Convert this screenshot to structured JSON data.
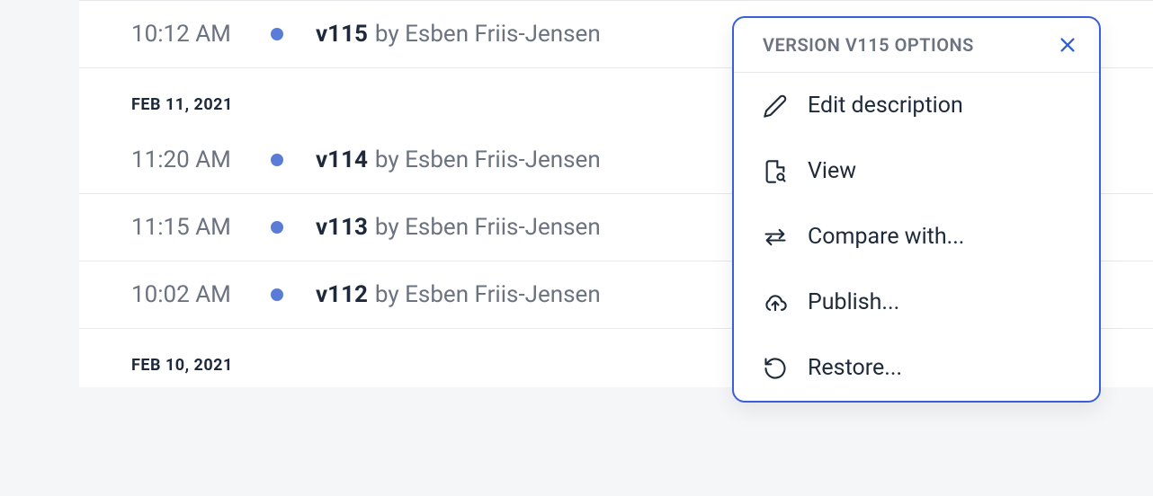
{
  "groups": [
    {
      "date": null,
      "rows": [
        {
          "time": "10:12 AM",
          "version": "v115",
          "by": "by Esben Friis-Jensen"
        }
      ]
    },
    {
      "date": "FEB 11, 2021",
      "rows": [
        {
          "time": "11:20 AM",
          "version": "v114",
          "by": "by Esben Friis-Jensen"
        },
        {
          "time": "11:15 AM",
          "version": "v113",
          "by": "by Esben Friis-Jensen"
        },
        {
          "time": "10:02 AM",
          "version": "v112",
          "by": "by Esben Friis-Jensen"
        }
      ]
    },
    {
      "date": "FEB 10, 2021",
      "rows": []
    }
  ],
  "options": {
    "title": "VERSION V115 OPTIONS",
    "items": [
      {
        "label": "Edit description"
      },
      {
        "label": "View"
      },
      {
        "label": "Compare with..."
      },
      {
        "label": "Publish..."
      },
      {
        "label": "Restore..."
      }
    ]
  }
}
